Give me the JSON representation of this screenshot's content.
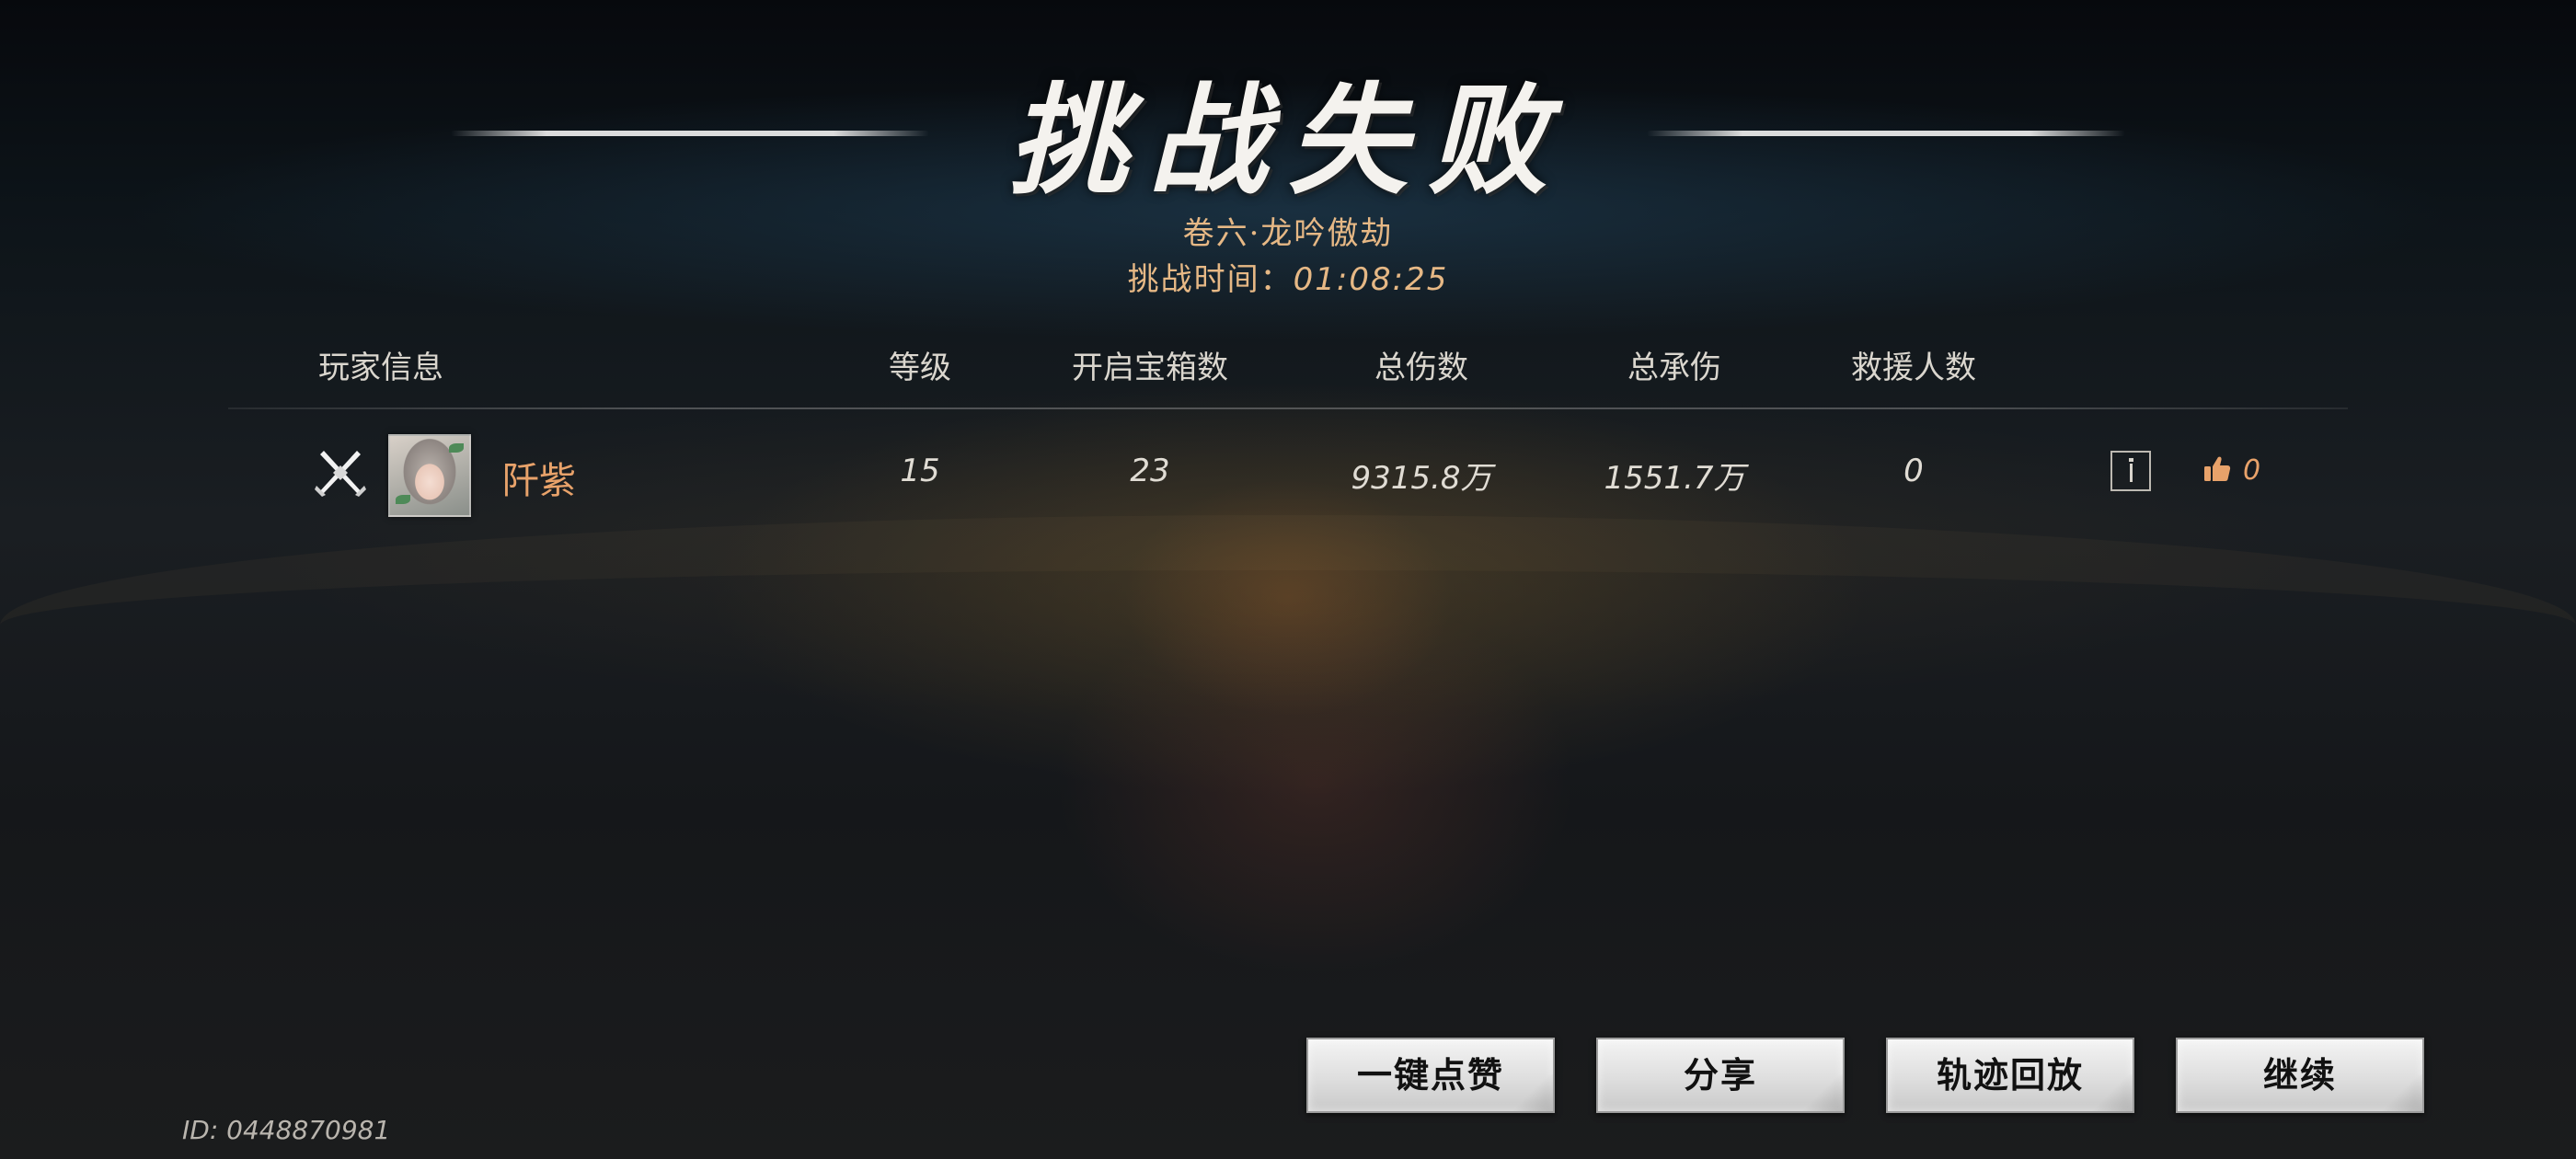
{
  "title": "挑战失败",
  "stage_name": "卷六·龙吟傲劫",
  "challenge_time": {
    "label": "挑战时间：",
    "value": "01:08:25"
  },
  "table": {
    "headers": {
      "player": "玩家信息",
      "level": "等级",
      "chests": "开启宝箱数",
      "damage": "总伤数",
      "damage_taken": "总承伤",
      "rescues": "救援人数"
    },
    "rows": [
      {
        "role_icon": "crossed-swords-icon",
        "name": "阡紫",
        "level": "15",
        "chests": "23",
        "damage": "9315.8万",
        "damage_taken": "1551.7万",
        "rescues": "0",
        "likes": "0"
      }
    ]
  },
  "buttons": {
    "like_all": "一键点赞",
    "share": "分享",
    "replay": "轨迹回放",
    "continue": "继续"
  },
  "id_text": "ID: 0448870981",
  "colors": {
    "accent": "#e8a26a",
    "subtitle": "#e6b885",
    "title": "#f4f2ee"
  }
}
